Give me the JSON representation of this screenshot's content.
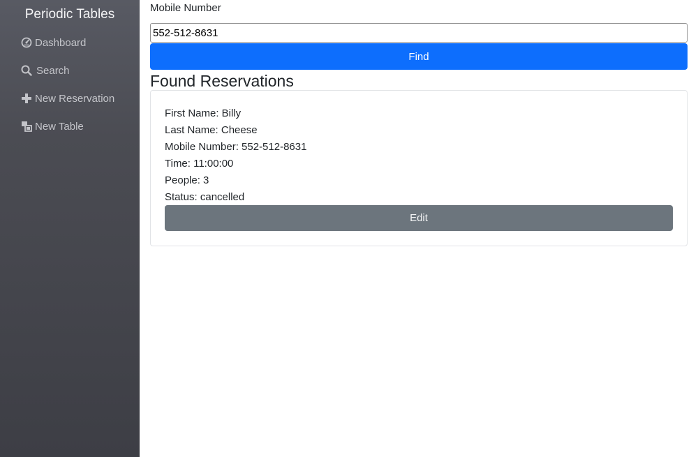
{
  "sidebar": {
    "brand": "Periodic Tables",
    "items": [
      {
        "label": "Dashboard",
        "icon": "dashboard-icon"
      },
      {
        "label": "Search",
        "icon": "search-icon"
      },
      {
        "label": "New Reservation",
        "icon": "plus-icon"
      },
      {
        "label": "New Table",
        "icon": "table-icon"
      }
    ]
  },
  "search": {
    "label": "Mobile Number",
    "value": "552-512-8631",
    "button": "Find"
  },
  "results": {
    "title": "Found Reservations",
    "reservation": {
      "first_name": "First Name: Billy",
      "last_name": "Last Name: Cheese",
      "mobile": "Mobile Number: 552-512-8631",
      "time": "Time: 11:00:00",
      "people": "People: 3",
      "status": "Status: cancelled",
      "edit_label": "Edit"
    }
  },
  "colors": {
    "primary": "#0d6efd",
    "secondary": "#6c757d",
    "sidebar": "#4b4c53"
  }
}
